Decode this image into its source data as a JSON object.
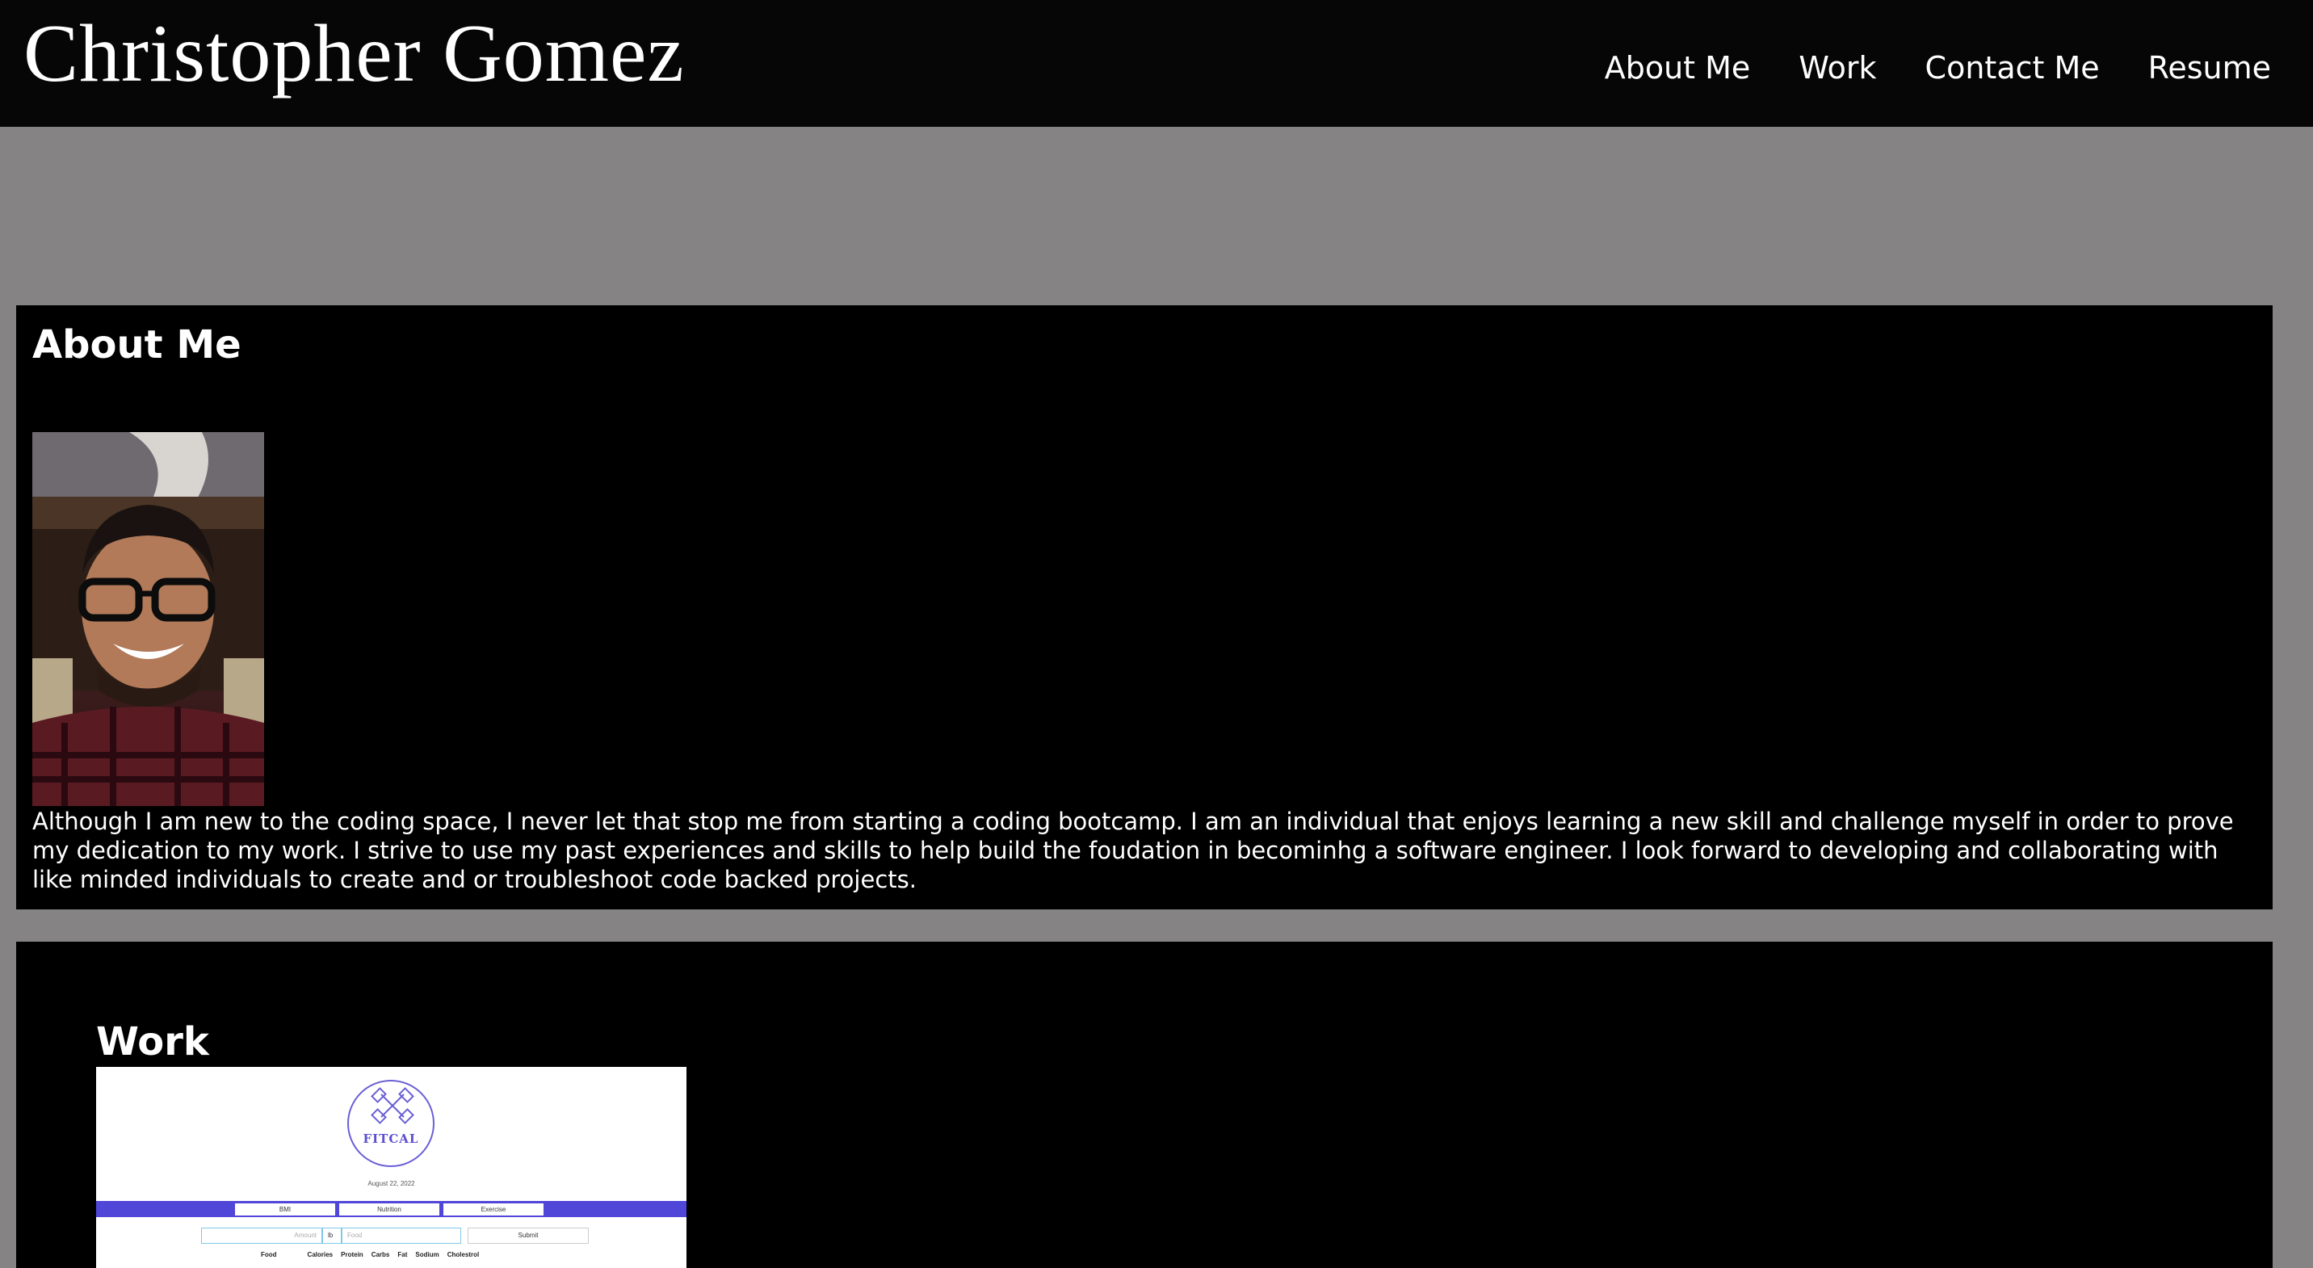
{
  "header": {
    "title": "Christopher Gomez",
    "nav": [
      {
        "label": "About Me"
      },
      {
        "label": "Work"
      },
      {
        "label": "Contact Me"
      },
      {
        "label": "Resume"
      }
    ]
  },
  "about": {
    "heading": "About Me",
    "text": "Although I am new to the coding space, I never let that stop me from starting a coding bootcamp. I am an individual that enjoys learning a new skill and challenge myself in order to prove my dedication to my work. I strive to use my past experiences and skills to help build the foudation in becominhg a software engineer. I look forward to developing and collaborating with like minded individuals to create and or troubleshoot code backed projects."
  },
  "work": {
    "heading": "Work",
    "project": {
      "logo_text": "FITCAL",
      "date": "August 22, 2022",
      "tabs": [
        "BMI",
        "Nutrition",
        "Exercise"
      ],
      "amount_placeholder": "Amount",
      "unit_value": "lb",
      "food_placeholder": "Food",
      "submit_label": "Submit",
      "columns": [
        "Food",
        "Calories",
        "Protein",
        "Carbs",
        "Fat",
        "Sodium",
        "Cholestrol"
      ]
    }
  },
  "colors": {
    "page_background": "#858384",
    "header_background": "#060606",
    "panel_background": "#000000",
    "text": "#ffffff",
    "project_accent": "#5046d8"
  }
}
